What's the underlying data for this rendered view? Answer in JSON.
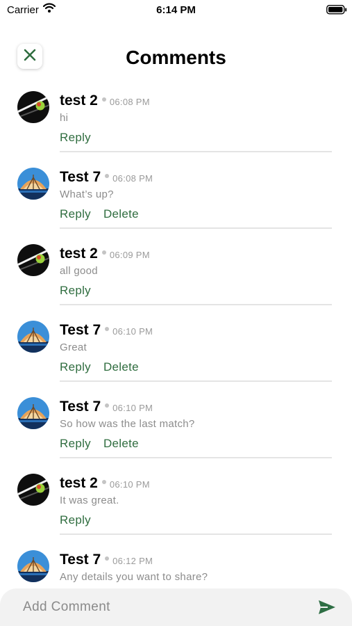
{
  "status_bar": {
    "carrier": "Carrier",
    "time": "6:14 PM"
  },
  "header": {
    "title": "Comments"
  },
  "comments": [
    {
      "name": "test 2",
      "time": "06:08 PM",
      "text": "hi",
      "reply_label": "Reply",
      "avatar": "tennis-ball-avatar"
    },
    {
      "name": "Test 7",
      "time": "06:08 PM",
      "text": "What’s up?",
      "reply_label": "Reply",
      "delete_label": "Delete",
      "avatar": "stadium-avatar"
    },
    {
      "name": "test 2",
      "time": "06:09 PM",
      "text": "all good",
      "reply_label": "Reply",
      "avatar": "tennis-ball-avatar"
    },
    {
      "name": "Test 7",
      "time": "06:10 PM",
      "text": "Great",
      "reply_label": "Reply",
      "delete_label": "Delete",
      "avatar": "stadium-avatar"
    },
    {
      "name": "Test 7",
      "time": "06:10 PM",
      "text": "So how was the last match?",
      "reply_label": "Reply",
      "delete_label": "Delete",
      "avatar": "stadium-avatar"
    },
    {
      "name": "test 2",
      "time": "06:10 PM",
      "text": "It was great.",
      "reply_label": "Reply",
      "avatar": "tennis-ball-avatar"
    },
    {
      "name": "Test 7",
      "time": "06:12 PM",
      "text": "Any details you want to share?",
      "avatar": "stadium-avatar"
    }
  ],
  "composer": {
    "placeholder": "Add Comment"
  },
  "colors": {
    "accent": "#2f6d3f",
    "send": "#2e6e44",
    "divider": "#e4e4e4"
  }
}
